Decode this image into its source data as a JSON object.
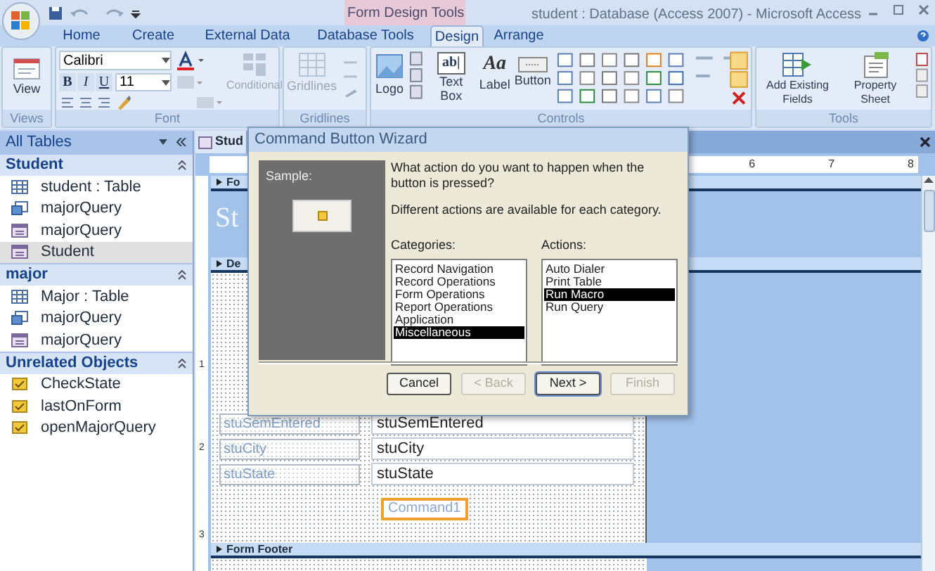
{
  "title_bar": {
    "context_label": "Form Design Tools",
    "title": "student : Database (Access 2007) - Microsoft Access"
  },
  "ribbon_tabs": [
    {
      "label": "Home",
      "selected": false
    },
    {
      "label": "Create",
      "selected": false
    },
    {
      "label": "External Data",
      "selected": false
    },
    {
      "label": "Database Tools",
      "selected": false
    },
    {
      "label": "Design",
      "selected": true
    },
    {
      "label": "Arrange",
      "selected": false
    }
  ],
  "ribbon": {
    "views": {
      "label": "Views",
      "button": "View"
    },
    "font": {
      "label": "Font",
      "font_name": "Calibri",
      "font_size": "11",
      "style_buttons": [
        "B",
        "I",
        "U"
      ],
      "conditional": {
        "label": "Conditional",
        "disabled": true
      }
    },
    "gridlines": {
      "label": "Gridlines",
      "button": {
        "label": "Gridlines",
        "disabled": true
      }
    },
    "controls": {
      "label": "Controls",
      "buttons": [
        {
          "label": "Logo",
          "kind": "logo"
        },
        {
          "label": "Text Box",
          "kind": "textbox",
          "glyph": "ab|"
        },
        {
          "label": "Label",
          "kind": "label",
          "glyph": "Aa"
        },
        {
          "label": "Button",
          "kind": "button"
        }
      ]
    },
    "tools": {
      "label": "Tools",
      "buttons": [
        "Add Existing Fields",
        "Property Sheet"
      ]
    }
  },
  "nav": {
    "header": "All Tables",
    "groups": [
      {
        "label": "Student",
        "items": [
          {
            "label": "student : Table",
            "kind": "table",
            "selected": false
          },
          {
            "label": "majorQuery",
            "kind": "query",
            "selected": false
          },
          {
            "label": "majorQuery",
            "kind": "form",
            "selected": false
          },
          {
            "label": "Student",
            "kind": "form",
            "selected": true
          }
        ]
      },
      {
        "label": "major",
        "items": [
          {
            "label": "Major : Table",
            "kind": "table",
            "selected": false
          },
          {
            "label": "majorQuery",
            "kind": "query",
            "selected": false
          },
          {
            "label": "majorQuery",
            "kind": "form",
            "selected": false
          }
        ]
      },
      {
        "label": "Unrelated Objects",
        "items": [
          {
            "label": "CheckState",
            "kind": "macro",
            "selected": false
          },
          {
            "label": "lastOnForm",
            "kind": "macro",
            "selected": false
          },
          {
            "label": "openMajorQuery",
            "kind": "macro",
            "selected": false
          }
        ]
      }
    ]
  },
  "document": {
    "tab": "Stud",
    "ruler_marks": [
      "6",
      "7",
      "8"
    ],
    "vertical_ruler_marks": [
      "1",
      "2",
      "3"
    ],
    "form_header_bar": "Fo",
    "form_title": "St",
    "detail_bar": "De",
    "fields": [
      {
        "label": "stuSemEntered",
        "value": "stuSemEntered"
      },
      {
        "label": "stuCity",
        "value": "stuCity"
      },
      {
        "label": "stuState",
        "value": "stuState"
      }
    ],
    "command_button": {
      "label": "Command1",
      "selected": true
    },
    "form_footer_bar": "Form Footer"
  },
  "dialog": {
    "title": "Command Button Wizard",
    "sample_label": "Sample:",
    "question": "What action do you want to happen when the button is pressed?",
    "hint": "Different actions are available for each category.",
    "categories_label": "Categories:",
    "categories": [
      {
        "label": "Record Navigation",
        "selected": false
      },
      {
        "label": "Record Operations",
        "selected": false
      },
      {
        "label": "Form Operations",
        "selected": false
      },
      {
        "label": "Report Operations",
        "selected": false
      },
      {
        "label": "Application",
        "selected": false
      },
      {
        "label": "Miscellaneous",
        "selected": true
      }
    ],
    "actions_label": "Actions:",
    "actions": [
      {
        "label": "Auto Dialer",
        "selected": false
      },
      {
        "label": "Print Table",
        "selected": false
      },
      {
        "label": "Run Macro",
        "selected": true
      },
      {
        "label": "Run Query",
        "selected": false
      }
    ],
    "buttons": [
      {
        "label": "Cancel",
        "disabled": false,
        "default": false
      },
      {
        "label": "< Back",
        "disabled": true,
        "default": false
      },
      {
        "label": "Next >",
        "disabled": false,
        "default": true
      },
      {
        "label": "Finish",
        "disabled": true,
        "default": false
      }
    ]
  }
}
